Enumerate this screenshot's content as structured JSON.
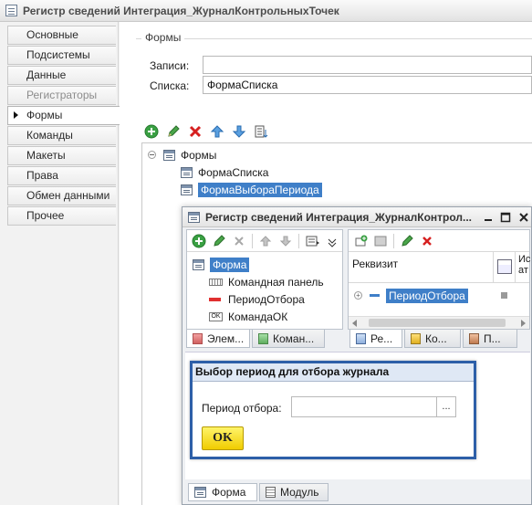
{
  "window": {
    "title": "Регистр сведений Интеграция_ЖурналКонтрольныхТочек"
  },
  "sidebar": {
    "items": [
      {
        "label": "Основные",
        "state": "normal"
      },
      {
        "label": "Подсистемы",
        "state": "normal"
      },
      {
        "label": "Данные",
        "state": "normal"
      },
      {
        "label": "Регистраторы",
        "state": "disabled"
      },
      {
        "label": "Формы",
        "state": "active"
      },
      {
        "label": "Команды",
        "state": "normal"
      },
      {
        "label": "Макеты",
        "state": "normal"
      },
      {
        "label": "Права",
        "state": "normal"
      },
      {
        "label": "Обмен данными",
        "state": "normal"
      },
      {
        "label": "Прочее",
        "state": "normal"
      }
    ]
  },
  "forms_group": {
    "title": "Формы",
    "record_label": "Записи:",
    "record_value": "",
    "list_label": "Списка:",
    "list_value": "ФормаСписка"
  },
  "forms_tree": {
    "root": "Формы",
    "items": [
      "ФормаСписка",
      "ФормаВыбораПериода"
    ],
    "selected": "ФормаВыбораПериода"
  },
  "inner_window": {
    "title": "Регистр сведений Интеграция_ЖурналКонтрол...",
    "elements_tree": {
      "root": "Форма",
      "items": [
        {
          "label": "Командная панель",
          "icon": "command-bar-icon"
        },
        {
          "label": "ПериодОтбора",
          "icon": "field-icon"
        },
        {
          "label": "КомандаОК",
          "icon": "ok-button-icon"
        }
      ]
    },
    "left_tabs": [
      "Элем...",
      "Коман..."
    ],
    "attrs": {
      "header": "Реквизит",
      "col2_header_line1": "Ис",
      "col2_header_line2": "ат",
      "row": "ПериодОтбора"
    },
    "right_tabs": [
      "Ре...",
      "Ко...",
      "П..."
    ],
    "dialog": {
      "title": "Выбор период для отбора журнала",
      "period_label": "Период отбора:",
      "period_value": "",
      "picker_label": "...",
      "ok_label": "OK"
    },
    "bottom_tabs": [
      "Форма",
      "Модуль"
    ]
  },
  "colors": {
    "selection": "#3f7fc8",
    "ok_button": "#f5d800",
    "dialog_border": "#2d5fa8"
  }
}
